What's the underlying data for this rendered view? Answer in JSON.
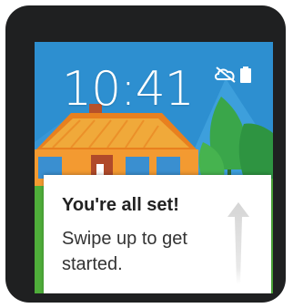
{
  "watch_face": {
    "time": "10:41",
    "status_icons": [
      "cloud-off-icon",
      "battery-icon"
    ]
  },
  "card": {
    "title": "You're all set!",
    "body": "Swipe up to get started.",
    "gesture_icon": "swipe-up-arrow-icon"
  },
  "colors": {
    "sky": "#2d8fd0",
    "house_roof": "#e8801f",
    "trees": "#3aa64a",
    "card_bg": "#ffffff",
    "bezel": "#1f2021"
  }
}
